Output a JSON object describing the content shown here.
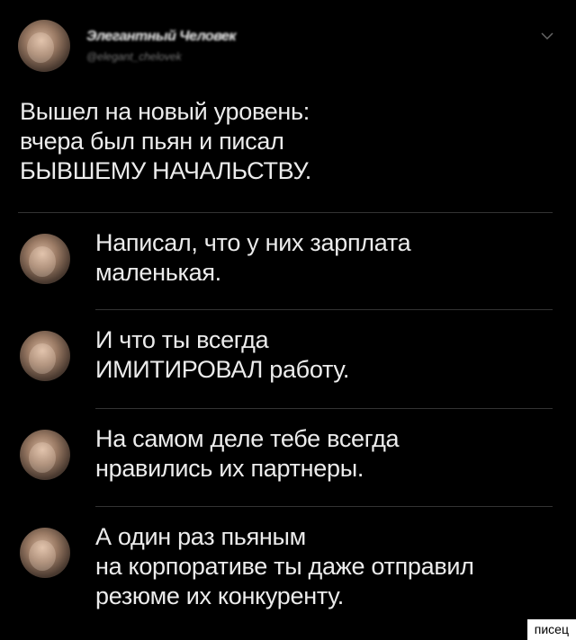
{
  "post": {
    "author_name": "Элегантный Человек",
    "author_handle": "@elegant_chelovek",
    "avatar_icon": "user-avatar-photo",
    "menu_icon": "chevron-down-icon",
    "text": "Вышел на новый уровень:\nвчера был пьян и писал\nБЫВШЕМУ НАЧАЛЬСТВУ."
  },
  "replies": [
    {
      "text": "Написал, что у них зарплата\nмаленькая.",
      "avatar_icon": "facepalm-avatar"
    },
    {
      "text": "И что ты всегда\nИМИТИРОВАЛ работу.",
      "avatar_icon": "facepalm-avatar"
    },
    {
      "text": "На самом деле тебе всегда\nнравились их партнеры.",
      "avatar_icon": "shocked-face-avatar"
    },
    {
      "text": "А один раз пьяным\nна корпоративе ты даже отправил\nрезюме их конкуренту.",
      "avatar_icon": "man-face-avatar"
    }
  ],
  "watermark": "писец",
  "colors": {
    "background": "#000000",
    "text": "#ececec",
    "divider": "#333333",
    "muted": "#777777"
  }
}
